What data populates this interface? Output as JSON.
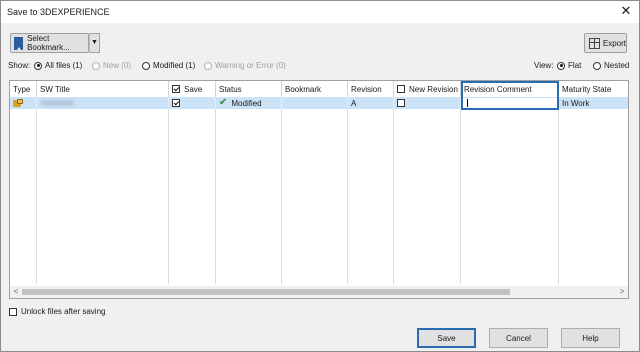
{
  "window": {
    "title": "Save to 3DEXPERIENCE",
    "close_glyph": "✕"
  },
  "toolbar": {
    "bookmark_label": "Select Bookmark...",
    "export_label": "Export"
  },
  "show": {
    "label": "Show:",
    "options": [
      {
        "label": "All files (1)",
        "selected": true,
        "enabled": true
      },
      {
        "label": "New (0)",
        "selected": false,
        "enabled": false
      },
      {
        "label": "Modified (1)",
        "selected": false,
        "enabled": true
      },
      {
        "label": "Warning or Error (0)",
        "selected": false,
        "enabled": false
      }
    ]
  },
  "view": {
    "label": "View:",
    "options": [
      {
        "label": "Flat",
        "selected": true
      },
      {
        "label": "Nested",
        "selected": false
      }
    ]
  },
  "table": {
    "columns": [
      "Type",
      "SW Title",
      "Save",
      "Status",
      "Bookmark",
      "Revision",
      "New Revision",
      "Revision Comment",
      "Maturity State"
    ],
    "rows": [
      {
        "type_icon": "solidworks-part-icon",
        "sw_title": "",
        "save": true,
        "status": "Modified",
        "bookmark": "",
        "revision": "A",
        "new_revision": false,
        "revision_comment": "",
        "maturity_state": "In Work"
      }
    ]
  },
  "footer": {
    "unlock_label": "Unlock files after saving",
    "unlock_checked": false,
    "save_label": "Save",
    "cancel_label": "Cancel",
    "help_label": "Help"
  },
  "colors": {
    "selection": "#cce3f7",
    "focus": "#2b6cb0",
    "status_ok": "#2e8b2e"
  }
}
